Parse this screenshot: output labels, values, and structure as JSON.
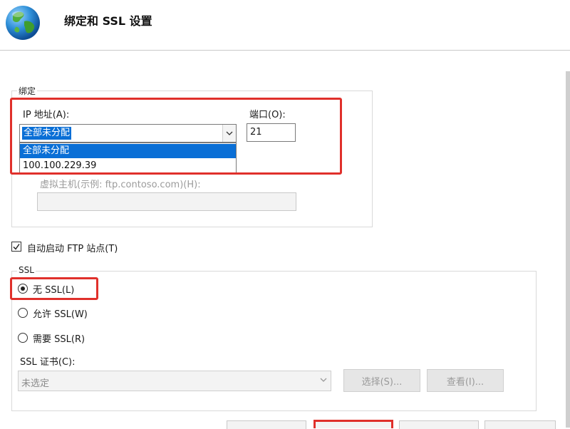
{
  "header": {
    "title": "绑定和 SSL 设置",
    "icon": "globe-icon"
  },
  "binding": {
    "group_label": "绑定",
    "ip_label": "IP 地址(A):",
    "ip_value": "全部未分配",
    "ip_options": [
      "全部未分配",
      "100.100.229.39"
    ],
    "port_label": "端口(O):",
    "port_value": "21",
    "host_label": "虚拟主机(示例: ftp.contoso.com)(H):",
    "host_value": ""
  },
  "autostart": {
    "label": "自动启动 FTP 站点(T)",
    "checked": true
  },
  "ssl": {
    "group_label": "SSL",
    "options": [
      {
        "label": "无 SSL(L)",
        "selected": true
      },
      {
        "label": "允许 SSL(W)",
        "selected": false
      },
      {
        "label": "需要 SSL(R)",
        "selected": false
      }
    ],
    "cert_label": "SSL 证书(C):",
    "cert_value": "未选定",
    "select_button": "选择(S)...",
    "view_button": "查看(I)..."
  },
  "colors": {
    "highlight": "#e0302b",
    "selection": "#0a6fd6"
  }
}
